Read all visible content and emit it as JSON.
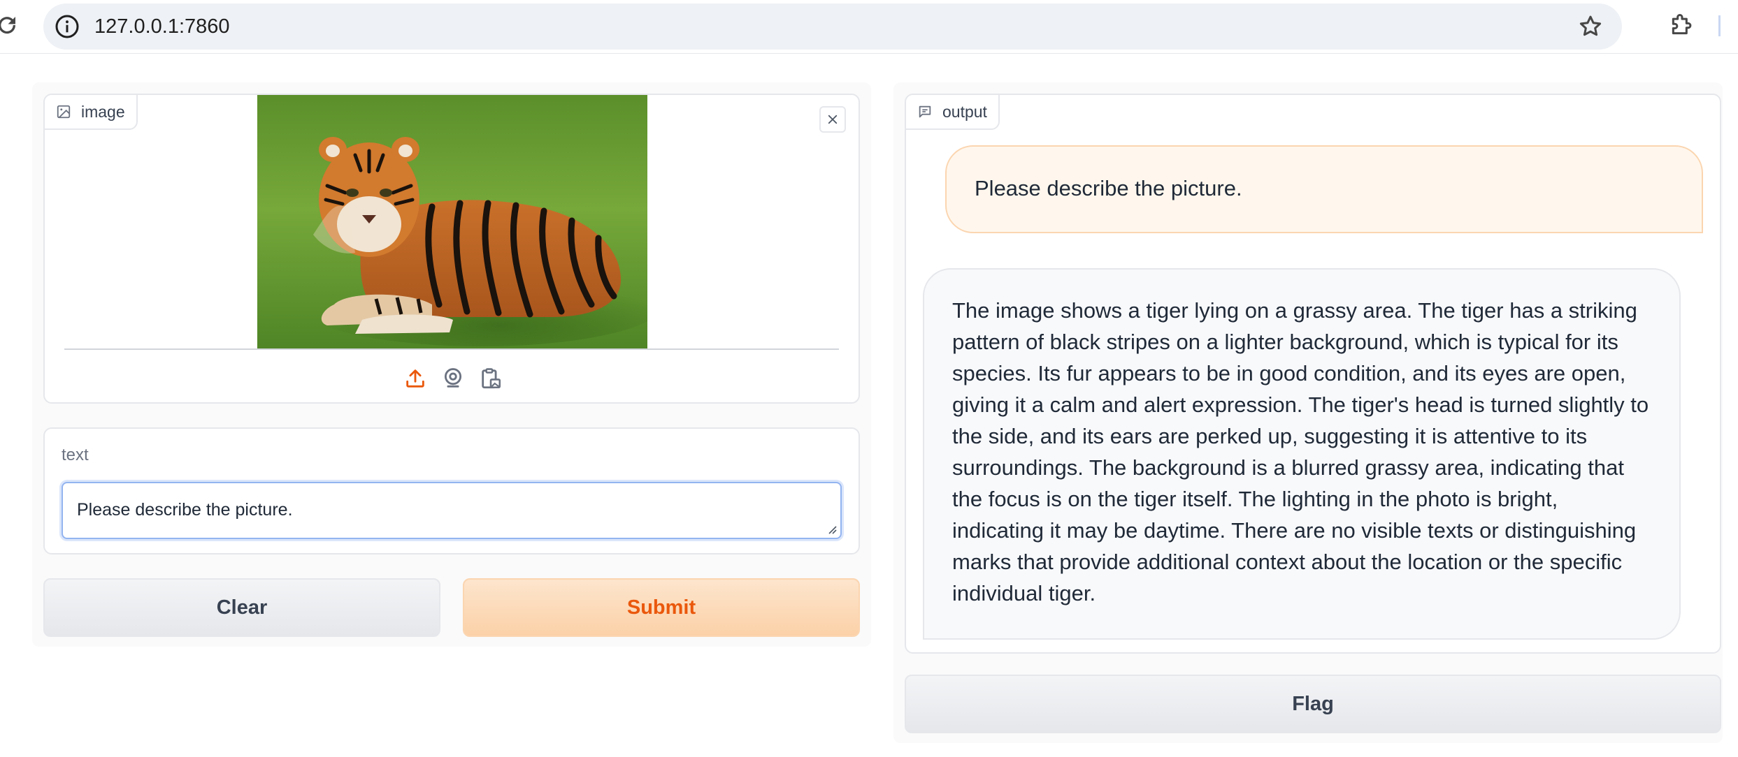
{
  "browser": {
    "url": "127.0.0.1:7860"
  },
  "image_input": {
    "label": "image",
    "source_icons": [
      "upload-icon",
      "webcam-icon",
      "clipboard-icon"
    ]
  },
  "text_input": {
    "label": "text",
    "value": "Please describe the picture."
  },
  "buttons": {
    "clear": "Clear",
    "submit": "Submit",
    "flag": "Flag"
  },
  "output": {
    "label": "output",
    "user_message": "Please describe the picture.",
    "bot_message": "The image shows a tiger lying on a grassy area. The tiger has a striking pattern of black stripes on a lighter background, which is typical for its species. Its fur appears to be in good condition, and its eyes are open, giving it a calm and alert expression. The tiger's head is turned slightly to the side, and its ears are perked up, suggesting it is attentive to its surroundings. The background is a blurred grassy area, indicating that the focus is on the tiger itself. The lighting in the photo is bright, indicating it may be daytime. There are no visible texts or distinguishing marks that provide additional context about the location or the specific individual tiger."
  },
  "colors": {
    "accent": "#ea580c",
    "submit_bg": "#fbd1a8",
    "user_bubble_bg": "#fff7ed",
    "textbox_focus": "#93b4f0"
  }
}
